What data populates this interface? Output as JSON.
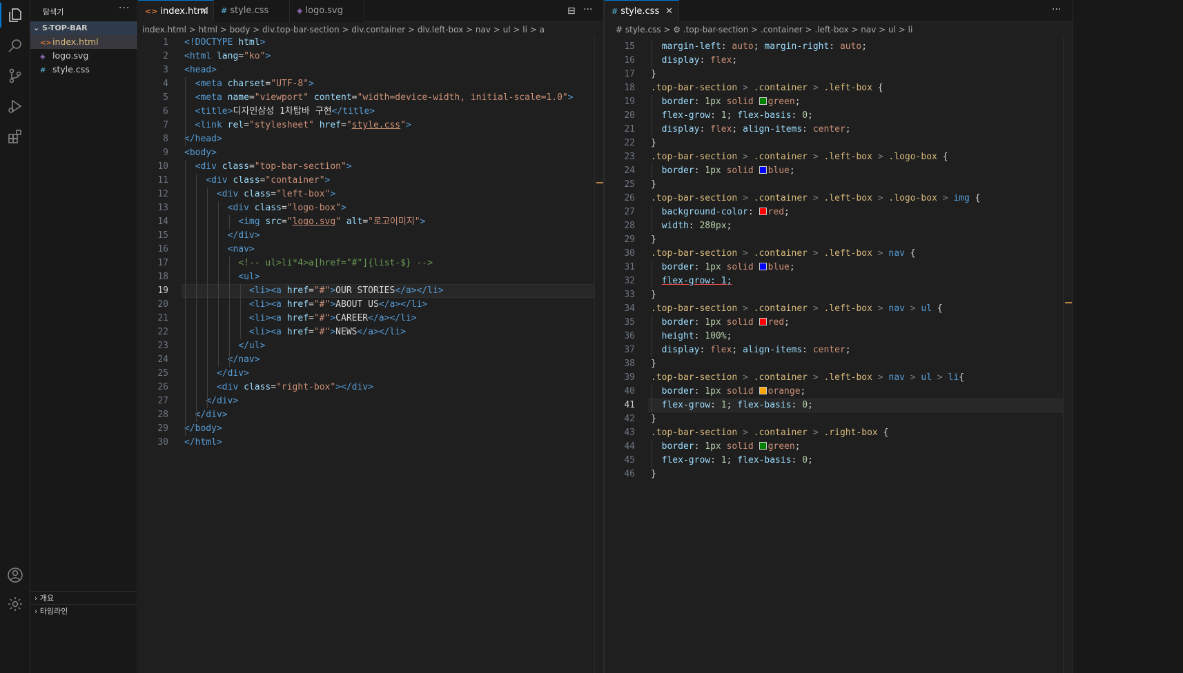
{
  "sidebar": {
    "title": "탐색기",
    "more": "···",
    "folder": "S-TOP-BAR",
    "files": [
      {
        "icon": "<>",
        "name": "index.html",
        "color": "#e37933"
      },
      {
        "icon": "◈",
        "name": "logo.svg",
        "color": "#a074c4"
      },
      {
        "icon": "#",
        "name": "style.css",
        "color": "#519aba"
      }
    ],
    "bottom": [
      "개요",
      "타임라인"
    ]
  },
  "left_editor": {
    "tabs": [
      {
        "icon": "<>",
        "label": "index.html",
        "close": "✕",
        "color": "#e37933"
      },
      {
        "icon": "#",
        "label": "style.css",
        "color": "#519aba"
      },
      {
        "icon": "◈",
        "label": "logo.svg",
        "color": "#a074c4"
      }
    ],
    "actions": [
      "⊟",
      "···"
    ],
    "breadcrumb": "index.html > html > body > div.top-bar-section > div.container > div.left-box > nav > ul > li > a",
    "lines": [
      {
        "n": "1",
        "h": "<span class='t'>&lt;!DOCTYPE</span> <span class='a'>html</span><span class='t'>&gt;</span>"
      },
      {
        "n": "2",
        "h": "<span class='t'>&lt;html</span> <span class='a'>lang</span>=<span class='s'>\"ko\"</span><span class='t'>&gt;</span>"
      },
      {
        "n": "3",
        "h": "<span class='t'>&lt;head&gt;</span>"
      },
      {
        "n": "4",
        "h": "  <span class='t'>&lt;meta</span> <span class='a'>charset</span>=<span class='s'>\"UTF-8\"</span><span class='t'>&gt;</span>"
      },
      {
        "n": "5",
        "h": "  <span class='t'>&lt;meta</span> <span class='a'>name</span>=<span class='s'>\"viewport\"</span> <span class='a'>content</span>=<span class='s'>\"width=device-width, initial-scale=1.0\"</span><span class='t'>&gt;</span>"
      },
      {
        "n": "6",
        "h": "  <span class='t'>&lt;title&gt;</span>디자인삼성 1차탑바 구현<span class='t'>&lt;/title&gt;</span>"
      },
      {
        "n": "7",
        "h": "  <span class='t'>&lt;link</span> <span class='a'>rel</span>=<span class='s'>\"stylesheet\"</span> <span class='a'>href</span>=<span class='s'>\"<u>style.css</u>\"</span><span class='t'>&gt;</span>"
      },
      {
        "n": "8",
        "h": "<span class='t'>&lt;/head&gt;</span>"
      },
      {
        "n": "9",
        "h": "<span class='t'>&lt;body&gt;</span>"
      },
      {
        "n": "10",
        "h": "  <span class='t'>&lt;div</span> <span class='a'>class</span>=<span class='s'>\"top-bar-section\"</span><span class='t'>&gt;</span>"
      },
      {
        "n": "11",
        "h": "    <span class='t'>&lt;div</span> <span class='a'>class</span>=<span class='s'>\"container\"</span><span class='t'>&gt;</span>"
      },
      {
        "n": "12",
        "h": "      <span class='t'>&lt;div</span> <span class='a'>class</span>=<span class='s'>\"left-box\"</span><span class='t'>&gt;</span>"
      },
      {
        "n": "13",
        "h": "        <span class='t'>&lt;div</span> <span class='a'>class</span>=<span class='s'>\"logo-box\"</span><span class='t'>&gt;</span>"
      },
      {
        "n": "14",
        "h": "          <span class='t'>&lt;img</span> <span class='a'>src</span>=<span class='s'>\"<u>logo.svg</u>\"</span> <span class='a'>alt</span>=<span class='s'>\"로고이미지\"</span><span class='t'>&gt;</span>"
      },
      {
        "n": "15",
        "h": "        <span class='t'>&lt;/div&gt;</span>"
      },
      {
        "n": "16",
        "h": "        <span class='t'>&lt;nav&gt;</span>"
      },
      {
        "n": "17",
        "h": "          <span class='c'>&lt;!-- ul&gt;li*4&gt;a[href=\"#\"]{list-$} --&gt;</span>"
      },
      {
        "n": "18",
        "h": "          <span class='t'>&lt;ul&gt;</span>"
      },
      {
        "n": "19",
        "h": "            <span class='t'>&lt;li&gt;&lt;a</span> <span class='a'>href</span>=<span class='s'>\"#\"</span><span class='t'>&gt;</span>OUR STORIES<span class='t'>&lt;/a&gt;&lt;/li&gt;</span>"
      },
      {
        "n": "20",
        "h": "            <span class='t'>&lt;li&gt;&lt;a</span> <span class='a'>href</span>=<span class='s'>\"#\"</span><span class='t'>&gt;</span>ABOUT US<span class='t'>&lt;/a&gt;&lt;/li&gt;</span>"
      },
      {
        "n": "21",
        "h": "            <span class='t'>&lt;li&gt;&lt;a</span> <span class='a'>href</span>=<span class='s'>\"#\"</span><span class='t'>&gt;</span>CAREER<span class='t'>&lt;/a&gt;&lt;/li&gt;</span>"
      },
      {
        "n": "22",
        "h": "            <span class='t'>&lt;li&gt;&lt;a</span> <span class='a'>href</span>=<span class='s'>\"#\"</span><span class='t'>&gt;</span>NEWS<span class='t'>&lt;/a&gt;&lt;/li&gt;</span>"
      },
      {
        "n": "23",
        "h": "          <span class='t'>&lt;/ul&gt;</span>"
      },
      {
        "n": "24",
        "h": "        <span class='t'>&lt;/nav&gt;</span>"
      },
      {
        "n": "25",
        "h": "      <span class='t'>&lt;/div&gt;</span>"
      },
      {
        "n": "26",
        "h": "      <span class='t'>&lt;div</span> <span class='a'>class</span>=<span class='s'>\"right-box\"</span><span class='t'>&gt;&lt;/div&gt;</span>"
      },
      {
        "n": "27",
        "h": "    <span class='t'>&lt;/div&gt;</span>"
      },
      {
        "n": "28",
        "h": "  <span class='t'>&lt;/div&gt;</span>"
      },
      {
        "n": "29",
        "h": "<span class='t'>&lt;/body&gt;</span>"
      },
      {
        "n": "30",
        "h": "<span class='t'>&lt;/html&gt;</span>"
      }
    ],
    "current_line": "19"
  },
  "right_editor": {
    "tabs": [
      {
        "icon": "#",
        "label": "style.css",
        "close": "✕",
        "color": "#519aba"
      }
    ],
    "actions": [
      "···"
    ],
    "breadcrumb": "# style.css > ⚙ .top-bar-section > .container > .left-box > nav > ul > li",
    "lines": [
      {
        "n": "15",
        "h": "  <span class='pr'>margin-left</span>: <span class='v'>auto</span>; <span class='pr'>margin-right</span>: <span class='v'>auto</span>;"
      },
      {
        "n": "16",
        "h": "  <span class='pr'>display</span>: <span class='v'>flex</span>;"
      },
      {
        "n": "17",
        "h": "}"
      },
      {
        "n": "18",
        "h": "<span class='sel'>.top-bar-section</span> <span class='p'>&gt;</span> <span class='sel'>.container</span> <span class='p'>&gt;</span> <span class='sel'>.left-box</span> {"
      },
      {
        "n": "19",
        "h": "  <span class='pr'>border</span>: <span class='n'>1px</span> <span class='v'>solid</span> <span class='sw' style='background:#008000'></span><span class='v'>green</span>;"
      },
      {
        "n": "20",
        "h": "  <span class='pr'>flex-grow</span>: <span class='n'>1</span>; <span class='pr'>flex-basis</span>: <span class='n'>0</span>;"
      },
      {
        "n": "21",
        "h": "  <span class='pr'>display</span>: <span class='v'>flex</span>; <span class='pr'>align-items</span>: <span class='v'>center</span>;"
      },
      {
        "n": "22",
        "h": "}"
      },
      {
        "n": "23",
        "h": "<span class='sel'>.top-bar-section</span> <span class='p'>&gt;</span> <span class='sel'>.container</span> <span class='p'>&gt;</span> <span class='sel'>.left-box</span> <span class='p'>&gt;</span> <span class='sel'>.logo-box</span> {"
      },
      {
        "n": "24",
        "h": "  <span class='pr'>border</span>: <span class='n'>1px</span> <span class='v'>solid</span> <span class='sw' style='background:#0000ff'></span><span class='v'>blue</span>;"
      },
      {
        "n": "25",
        "h": "}"
      },
      {
        "n": "26",
        "h": "<span class='sel'>.top-bar-section</span> <span class='p'>&gt;</span> <span class='sel'>.container</span> <span class='p'>&gt;</span> <span class='sel'>.left-box</span> <span class='p'>&gt;</span> <span class='sel'>.logo-box</span> <span class='p'>&gt;</span> <span class='t'>img</span> {"
      },
      {
        "n": "27",
        "h": "  <span class='pr'>background-color</span>: <span class='sw' style='background:#ff0000'></span><span class='v'>red</span>;"
      },
      {
        "n": "28",
        "h": "  <span class='pr'>width</span>: <span class='n'>280px</span>;"
      },
      {
        "n": "29",
        "h": "}"
      },
      {
        "n": "30",
        "h": "<span class='sel'>.top-bar-section</span> <span class='p'>&gt;</span> <span class='sel'>.container</span> <span class='p'>&gt;</span> <span class='sel'>.left-box</span> <span class='p'>&gt;</span> <span class='t'>nav</span> {"
      },
      {
        "n": "31",
        "h": "  <span class='pr'>border</span>: <span class='n'>1px</span> <span class='v'>solid</span> <span class='sw' style='background:#0000ff'></span><span class='v'>blue</span>;"
      },
      {
        "n": "32",
        "h": "  <span class='pr' style='text-decoration:underline;text-decoration-color:#f14c4c'>flex-grow: 1;</span>"
      },
      {
        "n": "33",
        "h": "}"
      },
      {
        "n": "34",
        "h": "<span class='sel'>.top-bar-section</span> <span class='p'>&gt;</span> <span class='sel'>.container</span> <span class='p'>&gt;</span> <span class='sel'>.left-box</span> <span class='p'>&gt;</span> <span class='t'>nav</span> <span class='p'>&gt;</span> <span class='t'>ul</span> {"
      },
      {
        "n": "35",
        "h": "  <span class='pr'>border</span>: <span class='n'>1px</span> <span class='v'>solid</span> <span class='sw' style='background:#ff0000'></span><span class='v'>red</span>;"
      },
      {
        "n": "36",
        "h": "  <span class='pr'>height</span>: <span class='n'>100%</span>;"
      },
      {
        "n": "37",
        "h": "  <span class='pr'>display</span>: <span class='v'>flex</span>; <span class='pr'>align-items</span>: <span class='v'>center</span>;"
      },
      {
        "n": "38",
        "h": "}"
      },
      {
        "n": "39",
        "h": "<span class='sel'>.top-bar-section</span> <span class='p'>&gt;</span> <span class='sel'>.container</span> <span class='p'>&gt;</span> <span class='sel'>.left-box</span> <span class='p'>&gt;</span> <span class='t'>nav</span> <span class='p'>&gt;</span> <span class='t'>ul</span> <span class='p'>&gt;</span> <span class='t'>li</span>{"
      },
      {
        "n": "40",
        "h": "  <span class='pr'>border</span>: <span class='n'>1px</span> <span class='v'>solid</span> <span class='sw' style='background:#ffa500'></span><span class='v'>orange</span>;"
      },
      {
        "n": "41",
        "h": "  <span class='pr'>flex-grow</span>: <span class='n'>1</span>; <span class='pr'>flex-basis</span>: <span class='n'>0</span>;"
      },
      {
        "n": "42",
        "h": "}"
      },
      {
        "n": "43",
        "h": "<span class='sel'>.top-bar-section</span> <span class='p'>&gt;</span> <span class='sel'>.container</span> <span class='p'>&gt;</span> <span class='sel'>.right-box</span> {"
      },
      {
        "n": "44",
        "h": "  <span class='pr'>border</span>: <span class='n'>1px</span> <span class='v'>solid</span> <span class='sw' style='background:#008000'></span><span class='v'>green</span>;"
      },
      {
        "n": "45",
        "h": "  <span class='pr'>flex-grow</span>: <span class='n'>1</span>; <span class='pr'>flex-basis</span>: <span class='n'>0</span>;"
      },
      {
        "n": "46",
        "h": "}"
      }
    ],
    "current_line": "41"
  },
  "colors": {
    "accent": "#0078d4",
    "background": "#1f1f1f",
    "sidebar_selected": "#37373d"
  }
}
